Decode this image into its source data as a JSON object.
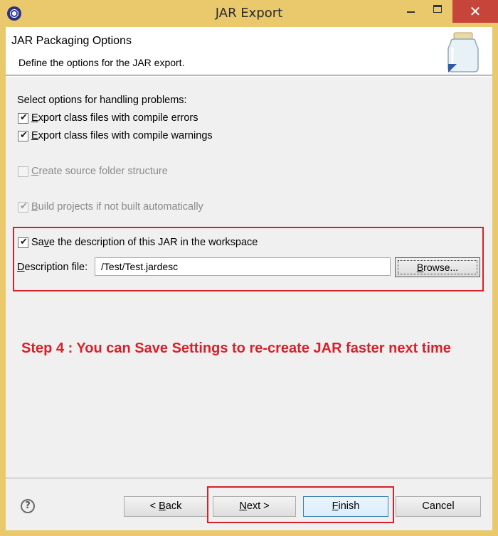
{
  "window": {
    "title": "JAR Export",
    "close_glyph": "✕"
  },
  "header": {
    "title": "JAR Packaging Options",
    "description": "Define the options for the JAR export."
  },
  "options": {
    "problems_label": "Select options for handling problems:",
    "compile_errors": {
      "mnemonic": "E",
      "rest": "xport class files with compile errors",
      "checked": true
    },
    "compile_warnings": {
      "mnemonic": "E",
      "rest": "xport class files with compile warnings",
      "checked": true
    },
    "source_folder": {
      "mnemonic": "C",
      "rest": "reate source folder structure",
      "checked": false,
      "enabled": false
    },
    "build_projects": {
      "mnemonic": "B",
      "rest": "uild projects if not built automatically",
      "checked": true,
      "enabled": false
    },
    "save_description": {
      "pre": "Sa",
      "mnemonic": "v",
      "rest": "e the description of this JAR in the workspace",
      "checked": true
    },
    "description_file": {
      "mnemonic": "D",
      "rest": "escription file:",
      "value": "/Test/Test.jardesc"
    },
    "browse": {
      "mnemonic": "B",
      "rest": "rowse..."
    }
  },
  "annotation": "Step 4 : You can Save Settings to re-create JAR faster next time",
  "footer": {
    "help_glyph": "?",
    "back": {
      "pre": "< ",
      "mnemonic": "B",
      "rest": "ack"
    },
    "next": {
      "mnemonic": "N",
      "rest": "ext >"
    },
    "finish": {
      "mnemonic": "F",
      "rest": "inish"
    },
    "cancel": "Cancel"
  },
  "colors": {
    "titlebar": "#e9c96b",
    "highlight": "#d8202a",
    "close_button": "#c7443a"
  },
  "icons": {
    "app": "eclipse-icon",
    "wizard": "jar-icon",
    "check": "✔"
  }
}
